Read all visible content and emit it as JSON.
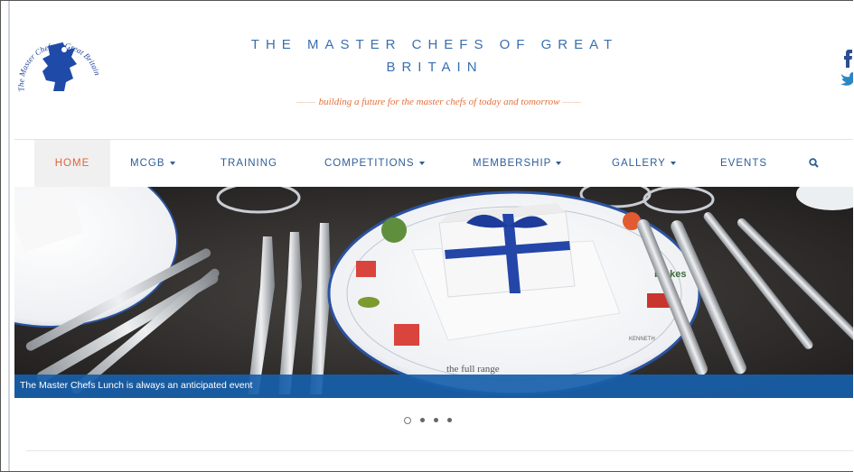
{
  "header": {
    "title": "THE MASTER CHEFS OF GREAT BRITAIN",
    "tagline": "building a future for the master chefs of today and tomorrow",
    "logo_text": "The Master Chefs of Great Britain"
  },
  "nav": {
    "items": [
      {
        "label": "HOME",
        "active": true
      },
      {
        "label": "MCGB",
        "dropdown": true
      },
      {
        "label": "TRAINING"
      },
      {
        "label": "COMPETITIONS",
        "dropdown": true
      },
      {
        "label": "MEMBERSHIP",
        "dropdown": true
      },
      {
        "label": "GALLERY",
        "dropdown": true
      },
      {
        "label": "EVENTS"
      }
    ],
    "search_icon": "search-icon"
  },
  "hero": {
    "caption": "The Master Chefs Lunch is always an anticipated event",
    "plate_brands": [
      "the full range",
      "brakes",
      "KENNETH"
    ]
  },
  "carousel": {
    "slides": 4,
    "active": 1
  },
  "colors": {
    "brand_blue": "#2e5e98",
    "accent_orange": "#e0643a",
    "caption_blue": "#185faa"
  }
}
